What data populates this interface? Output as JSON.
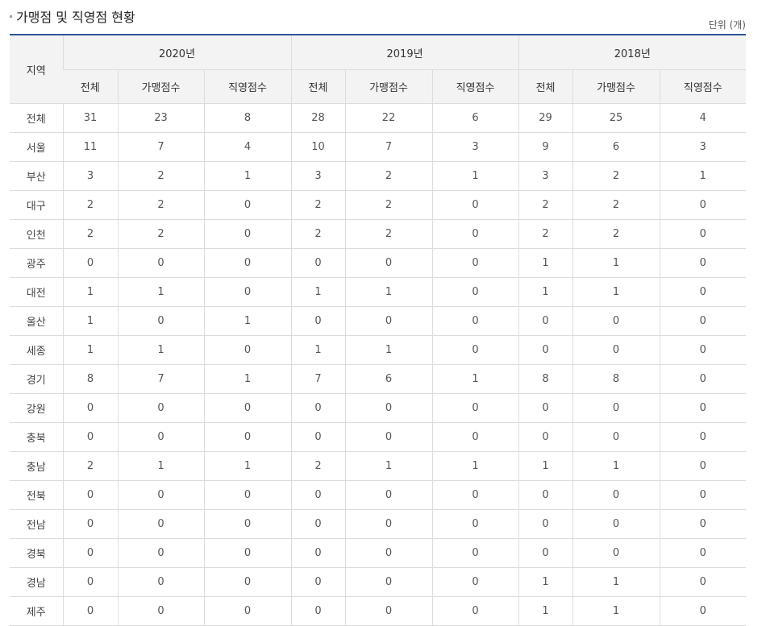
{
  "title": "가맹점 및 직영점 현황",
  "unit": "단위 (개)",
  "header": {
    "region": "지역",
    "years": [
      "2020년",
      "2019년",
      "2018년"
    ],
    "sub": [
      "전체",
      "가맹점수",
      "직영점수"
    ]
  },
  "rows": [
    {
      "region": "전체",
      "values": [
        "31",
        "23",
        "8",
        "28",
        "22",
        "6",
        "29",
        "25",
        "4"
      ]
    },
    {
      "region": "서울",
      "values": [
        "11",
        "7",
        "4",
        "10",
        "7",
        "3",
        "9",
        "6",
        "3"
      ]
    },
    {
      "region": "부산",
      "values": [
        "3",
        "2",
        "1",
        "3",
        "2",
        "1",
        "3",
        "2",
        "1"
      ]
    },
    {
      "region": "대구",
      "values": [
        "2",
        "2",
        "0",
        "2",
        "2",
        "0",
        "2",
        "2",
        "0"
      ]
    },
    {
      "region": "인천",
      "values": [
        "2",
        "2",
        "0",
        "2",
        "2",
        "0",
        "2",
        "2",
        "0"
      ]
    },
    {
      "region": "광주",
      "values": [
        "0",
        "0",
        "0",
        "0",
        "0",
        "0",
        "1",
        "1",
        "0"
      ]
    },
    {
      "region": "대전",
      "values": [
        "1",
        "1",
        "0",
        "1",
        "1",
        "0",
        "1",
        "1",
        "0"
      ]
    },
    {
      "region": "울산",
      "values": [
        "1",
        "0",
        "1",
        "0",
        "0",
        "0",
        "0",
        "0",
        "0"
      ]
    },
    {
      "region": "세종",
      "values": [
        "1",
        "1",
        "0",
        "1",
        "1",
        "0",
        "0",
        "0",
        "0"
      ]
    },
    {
      "region": "경기",
      "values": [
        "8",
        "7",
        "1",
        "7",
        "6",
        "1",
        "8",
        "8",
        "0"
      ]
    },
    {
      "region": "강원",
      "values": [
        "0",
        "0",
        "0",
        "0",
        "0",
        "0",
        "0",
        "0",
        "0"
      ]
    },
    {
      "region": "충북",
      "values": [
        "0",
        "0",
        "0",
        "0",
        "0",
        "0",
        "0",
        "0",
        "0"
      ]
    },
    {
      "region": "충남",
      "values": [
        "2",
        "1",
        "1",
        "2",
        "1",
        "1",
        "1",
        "1",
        "0"
      ]
    },
    {
      "region": "전북",
      "values": [
        "0",
        "0",
        "0",
        "0",
        "0",
        "0",
        "0",
        "0",
        "0"
      ]
    },
    {
      "region": "전남",
      "values": [
        "0",
        "0",
        "0",
        "0",
        "0",
        "0",
        "0",
        "0",
        "0"
      ]
    },
    {
      "region": "경북",
      "values": [
        "0",
        "0",
        "0",
        "0",
        "0",
        "0",
        "0",
        "0",
        "0"
      ]
    },
    {
      "region": "경남",
      "values": [
        "0",
        "0",
        "0",
        "0",
        "0",
        "0",
        "1",
        "1",
        "0"
      ]
    },
    {
      "region": "제주",
      "values": [
        "0",
        "0",
        "0",
        "0",
        "0",
        "0",
        "1",
        "1",
        "0"
      ]
    }
  ]
}
